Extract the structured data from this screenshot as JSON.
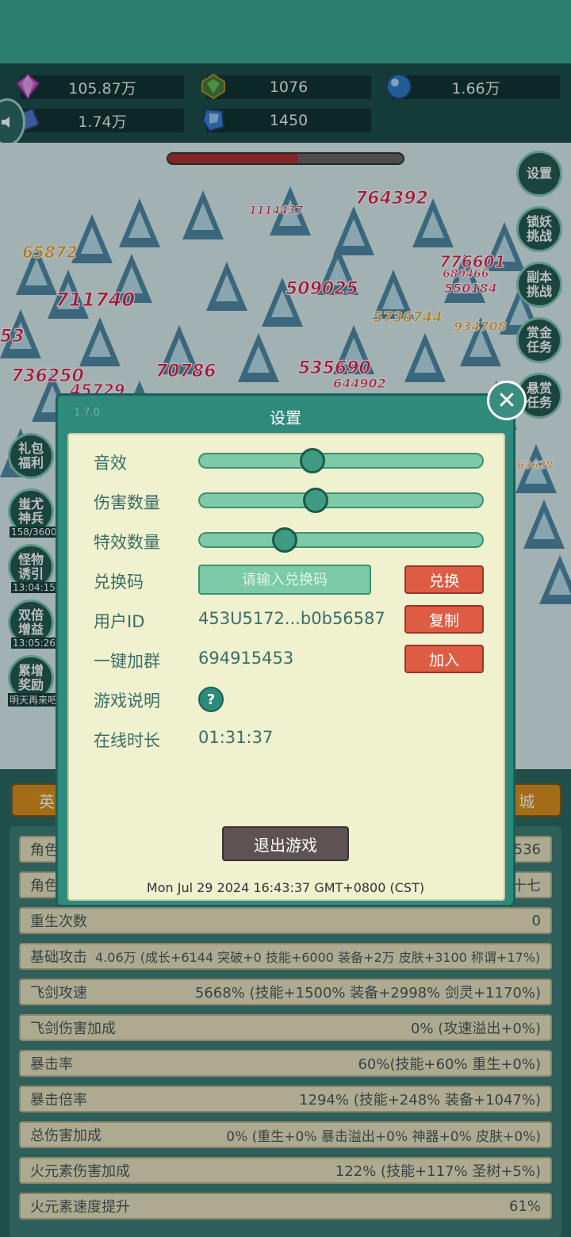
{
  "resources": [
    {
      "icon": "gem-icon",
      "value": "105.87万"
    },
    {
      "icon": "green-crystal-icon",
      "value": "1076"
    },
    {
      "icon": "blue-orb-icon",
      "value": "1.66万"
    },
    {
      "icon": "scroll-icon",
      "value": "1.74万"
    },
    {
      "icon": "blue-stone-icon",
      "value": "1450"
    }
  ],
  "damage_numbers": [
    "764392",
    "1114437",
    "65872",
    "776601",
    "689466",
    "550184",
    "509025",
    "711740",
    "5736744",
    "934708",
    "736250",
    "70786",
    "535690",
    "644902",
    "53",
    "45729",
    "63628"
  ],
  "side_right": [
    "设置",
    "锁妖\n挑战",
    "副本\n挑战",
    "赏金\n任务",
    "悬赏\n任务"
  ],
  "side_left": [
    {
      "label": "礼包\n福利",
      "timer": ""
    },
    {
      "label": "蚩尤\n神兵",
      "timer": "158/3600"
    },
    {
      "label": "怪物\n诱引",
      "timer": "13:04:15"
    },
    {
      "label": "双倍\n增益",
      "timer": "13:05:26"
    },
    {
      "label": "累增\n奖励",
      "timer": "明天再来吧"
    }
  ],
  "tabs": {
    "left": "英",
    "right": "城"
  },
  "stats_partial": [
    {
      "label": "角色",
      "value": "536"
    },
    {
      "label": "角色",
      "value": "十七"
    }
  ],
  "stats": [
    {
      "label": "重生次数",
      "value": "0"
    },
    {
      "label": "基础攻击",
      "value": "4.06万 (成长+6144 突破+0 技能+6000 装备+2万 皮肤+3100 称谓+17%)"
    },
    {
      "label": "飞剑攻速",
      "value": "5668% (技能+1500% 装备+2998% 剑灵+1170%)"
    },
    {
      "label": "飞剑伤害加成",
      "value": "0% (攻速溢出+0%)"
    },
    {
      "label": "暴击率",
      "value": "60%(技能+60% 重生+0%)"
    },
    {
      "label": "暴击倍率",
      "value": "1294% (技能+248% 装备+1047%)"
    },
    {
      "label": "总伤害加成",
      "value": "0% (重生+0% 暴击溢出+0% 神器+0% 皮肤+0%)"
    },
    {
      "label": "火元素伤害加成",
      "value": "122% (技能+117% 圣树+5%)"
    },
    {
      "label": "火元素速度提升",
      "value": "61%"
    }
  ],
  "dialog": {
    "version": "1.7.0",
    "title": "设置",
    "sound_label": "音效",
    "sound_level": 0.4,
    "damage_count_label": "伤害数量",
    "damage_count_level": 0.41,
    "effect_count_label": "特效数量",
    "effect_count_level": 0.3,
    "code_label": "兑换码",
    "code_placeholder": "请输入兑换码",
    "redeem_button": "兑换",
    "user_id_label": "用户ID",
    "user_id_value": "453U5172...b0b56587",
    "copy_button": "复制",
    "group_label": "一键加群",
    "group_value": "694915453",
    "join_button": "加入",
    "help_label": "游戏说明",
    "help_icon": "?",
    "online_label": "在线时长",
    "online_value": "01:31:37",
    "exit_button": "退出游戏",
    "datetime": "Mon Jul 29 2024 16:43:37 GMT+0800 (CST)"
  },
  "colors": {
    "topbar": "#3aa893",
    "dialog": "#2f8a7c",
    "panel": "#eff1cf",
    "red_button": "#de5c44",
    "slider": "#7ccaa6"
  }
}
